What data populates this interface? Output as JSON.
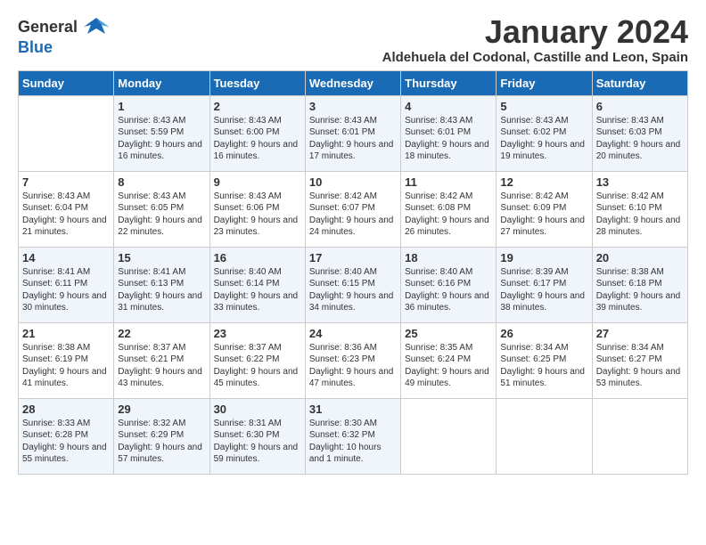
{
  "header": {
    "logo_general": "General",
    "logo_blue": "Blue",
    "month_title": "January 2024",
    "location": "Aldehuela del Codonal, Castille and Leon, Spain"
  },
  "weekdays": [
    "Sunday",
    "Monday",
    "Tuesday",
    "Wednesday",
    "Thursday",
    "Friday",
    "Saturday"
  ],
  "weeks": [
    [
      {
        "day": "",
        "sunrise": "",
        "sunset": "",
        "daylight": ""
      },
      {
        "day": "1",
        "sunrise": "Sunrise: 8:43 AM",
        "sunset": "Sunset: 5:59 PM",
        "daylight": "Daylight: 9 hours and 16 minutes."
      },
      {
        "day": "2",
        "sunrise": "Sunrise: 8:43 AM",
        "sunset": "Sunset: 6:00 PM",
        "daylight": "Daylight: 9 hours and 16 minutes."
      },
      {
        "day": "3",
        "sunrise": "Sunrise: 8:43 AM",
        "sunset": "Sunset: 6:01 PM",
        "daylight": "Daylight: 9 hours and 17 minutes."
      },
      {
        "day": "4",
        "sunrise": "Sunrise: 8:43 AM",
        "sunset": "Sunset: 6:01 PM",
        "daylight": "Daylight: 9 hours and 18 minutes."
      },
      {
        "day": "5",
        "sunrise": "Sunrise: 8:43 AM",
        "sunset": "Sunset: 6:02 PM",
        "daylight": "Daylight: 9 hours and 19 minutes."
      },
      {
        "day": "6",
        "sunrise": "Sunrise: 8:43 AM",
        "sunset": "Sunset: 6:03 PM",
        "daylight": "Daylight: 9 hours and 20 minutes."
      }
    ],
    [
      {
        "day": "7",
        "sunrise": "Sunrise: 8:43 AM",
        "sunset": "Sunset: 6:04 PM",
        "daylight": "Daylight: 9 hours and 21 minutes."
      },
      {
        "day": "8",
        "sunrise": "Sunrise: 8:43 AM",
        "sunset": "Sunset: 6:05 PM",
        "daylight": "Daylight: 9 hours and 22 minutes."
      },
      {
        "day": "9",
        "sunrise": "Sunrise: 8:43 AM",
        "sunset": "Sunset: 6:06 PM",
        "daylight": "Daylight: 9 hours and 23 minutes."
      },
      {
        "day": "10",
        "sunrise": "Sunrise: 8:42 AM",
        "sunset": "Sunset: 6:07 PM",
        "daylight": "Daylight: 9 hours and 24 minutes."
      },
      {
        "day": "11",
        "sunrise": "Sunrise: 8:42 AM",
        "sunset": "Sunset: 6:08 PM",
        "daylight": "Daylight: 9 hours and 26 minutes."
      },
      {
        "day": "12",
        "sunrise": "Sunrise: 8:42 AM",
        "sunset": "Sunset: 6:09 PM",
        "daylight": "Daylight: 9 hours and 27 minutes."
      },
      {
        "day": "13",
        "sunrise": "Sunrise: 8:42 AM",
        "sunset": "Sunset: 6:10 PM",
        "daylight": "Daylight: 9 hours and 28 minutes."
      }
    ],
    [
      {
        "day": "14",
        "sunrise": "Sunrise: 8:41 AM",
        "sunset": "Sunset: 6:11 PM",
        "daylight": "Daylight: 9 hours and 30 minutes."
      },
      {
        "day": "15",
        "sunrise": "Sunrise: 8:41 AM",
        "sunset": "Sunset: 6:13 PM",
        "daylight": "Daylight: 9 hours and 31 minutes."
      },
      {
        "day": "16",
        "sunrise": "Sunrise: 8:40 AM",
        "sunset": "Sunset: 6:14 PM",
        "daylight": "Daylight: 9 hours and 33 minutes."
      },
      {
        "day": "17",
        "sunrise": "Sunrise: 8:40 AM",
        "sunset": "Sunset: 6:15 PM",
        "daylight": "Daylight: 9 hours and 34 minutes."
      },
      {
        "day": "18",
        "sunrise": "Sunrise: 8:40 AM",
        "sunset": "Sunset: 6:16 PM",
        "daylight": "Daylight: 9 hours and 36 minutes."
      },
      {
        "day": "19",
        "sunrise": "Sunrise: 8:39 AM",
        "sunset": "Sunset: 6:17 PM",
        "daylight": "Daylight: 9 hours and 38 minutes."
      },
      {
        "day": "20",
        "sunrise": "Sunrise: 8:38 AM",
        "sunset": "Sunset: 6:18 PM",
        "daylight": "Daylight: 9 hours and 39 minutes."
      }
    ],
    [
      {
        "day": "21",
        "sunrise": "Sunrise: 8:38 AM",
        "sunset": "Sunset: 6:19 PM",
        "daylight": "Daylight: 9 hours and 41 minutes."
      },
      {
        "day": "22",
        "sunrise": "Sunrise: 8:37 AM",
        "sunset": "Sunset: 6:21 PM",
        "daylight": "Daylight: 9 hours and 43 minutes."
      },
      {
        "day": "23",
        "sunrise": "Sunrise: 8:37 AM",
        "sunset": "Sunset: 6:22 PM",
        "daylight": "Daylight: 9 hours and 45 minutes."
      },
      {
        "day": "24",
        "sunrise": "Sunrise: 8:36 AM",
        "sunset": "Sunset: 6:23 PM",
        "daylight": "Daylight: 9 hours and 47 minutes."
      },
      {
        "day": "25",
        "sunrise": "Sunrise: 8:35 AM",
        "sunset": "Sunset: 6:24 PM",
        "daylight": "Daylight: 9 hours and 49 minutes."
      },
      {
        "day": "26",
        "sunrise": "Sunrise: 8:34 AM",
        "sunset": "Sunset: 6:25 PM",
        "daylight": "Daylight: 9 hours and 51 minutes."
      },
      {
        "day": "27",
        "sunrise": "Sunrise: 8:34 AM",
        "sunset": "Sunset: 6:27 PM",
        "daylight": "Daylight: 9 hours and 53 minutes."
      }
    ],
    [
      {
        "day": "28",
        "sunrise": "Sunrise: 8:33 AM",
        "sunset": "Sunset: 6:28 PM",
        "daylight": "Daylight: 9 hours and 55 minutes."
      },
      {
        "day": "29",
        "sunrise": "Sunrise: 8:32 AM",
        "sunset": "Sunset: 6:29 PM",
        "daylight": "Daylight: 9 hours and 57 minutes."
      },
      {
        "day": "30",
        "sunrise": "Sunrise: 8:31 AM",
        "sunset": "Sunset: 6:30 PM",
        "daylight": "Daylight: 9 hours and 59 minutes."
      },
      {
        "day": "31",
        "sunrise": "Sunrise: 8:30 AM",
        "sunset": "Sunset: 6:32 PM",
        "daylight": "Daylight: 10 hours and 1 minute."
      },
      {
        "day": "",
        "sunrise": "",
        "sunset": "",
        "daylight": ""
      },
      {
        "day": "",
        "sunrise": "",
        "sunset": "",
        "daylight": ""
      },
      {
        "day": "",
        "sunrise": "",
        "sunset": "",
        "daylight": ""
      }
    ]
  ]
}
